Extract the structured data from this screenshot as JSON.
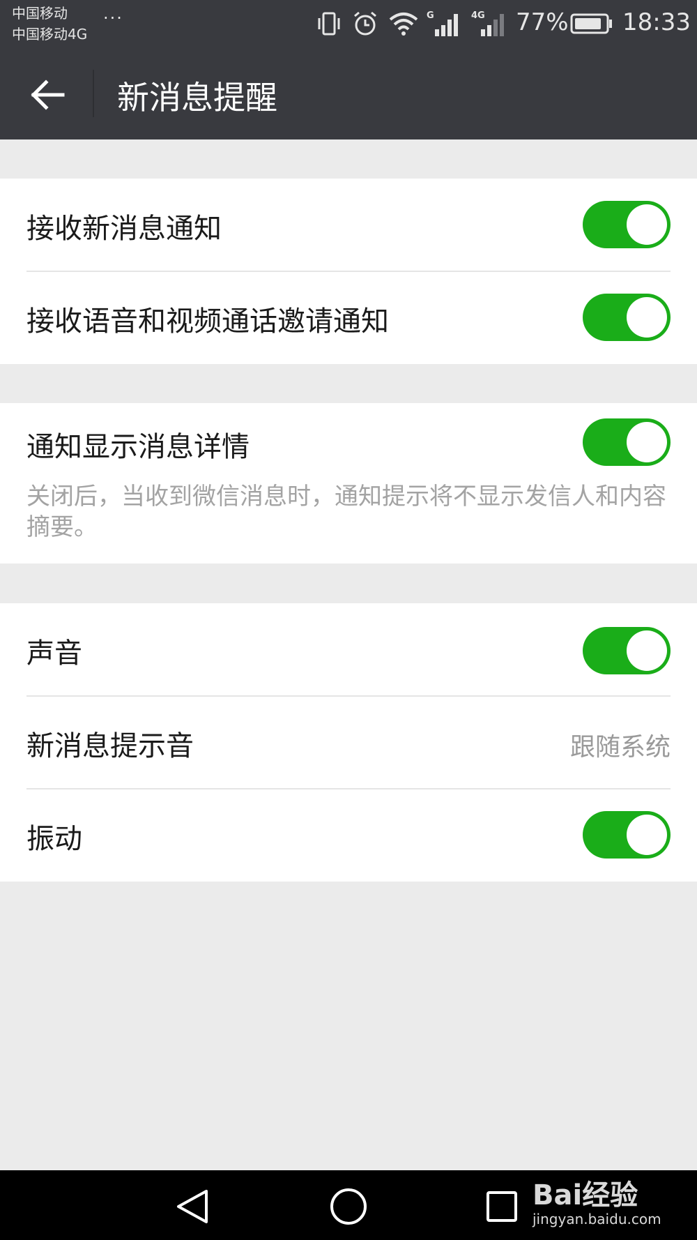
{
  "status_bar": {
    "carrier_1": "中国移动",
    "carrier_2": "中国移动4G",
    "dots": "···",
    "battery": "77%",
    "time": "18:33",
    "icons": [
      "vibrate-icon",
      "alarm-icon",
      "wifi-icon",
      "signal-g-icon",
      "signal-4g-icon",
      "battery-icon"
    ]
  },
  "header": {
    "title": "新消息提醒",
    "back_icon": "back-arrow-icon"
  },
  "group1": {
    "rows": [
      {
        "label": "接收新消息通知",
        "toggle": true
      },
      {
        "label": "接收语音和视频通话邀请通知",
        "toggle": true
      }
    ]
  },
  "group2": {
    "label": "通知显示消息详情",
    "toggle": true,
    "description": "关闭后，当收到微信消息时，通知提示将不显示发信人和内容摘要。"
  },
  "group3": {
    "sound_label": "声音",
    "sound_toggle": true,
    "ringtone_label": "新消息提示音",
    "ringtone_value": "跟随系统",
    "vibrate_label": "振动",
    "vibrate_toggle": true
  },
  "nav_bar": {
    "icons": [
      "nav-back-icon",
      "nav-home-icon",
      "nav-recents-icon"
    ]
  },
  "watermark": {
    "logo": "Bai经验",
    "url": "jingyan.baidu.com"
  },
  "colors": {
    "toolbar": "#393a3f",
    "accent_green": "#1aad19",
    "background": "#ebebeb"
  }
}
